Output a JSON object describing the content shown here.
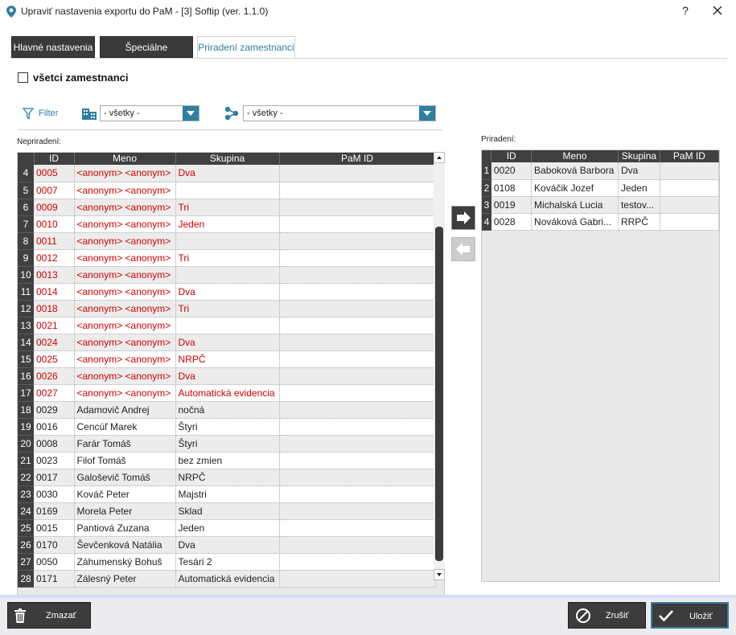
{
  "window": {
    "title": "Upraviť nastavenia exportu do PaM - [3] Softip (ver. 1.1.0)",
    "help_label": "?",
    "icons": {
      "app": "location-pin-icon",
      "close": "close-icon"
    }
  },
  "tabs": [
    {
      "label": "Hlavné nastavenia",
      "active": false
    },
    {
      "label": "Špeciálne nastavenia",
      "active": false
    },
    {
      "label": "Priradení zamestnanci",
      "active": true
    }
  ],
  "all_employees": {
    "label": "všetci zamestnanci",
    "checked": false
  },
  "filters": {
    "filter_label": "Filter",
    "combo1": {
      "value": "- všetky -",
      "icon": "building-icon"
    },
    "combo2": {
      "value": "- všetky -",
      "icon": "network-icon"
    }
  },
  "unassigned": {
    "label": "Nepriradení:",
    "columns": [
      "ID",
      "Meno",
      "Skupina",
      "PaM ID"
    ],
    "rows": [
      {
        "n": "4",
        "id": "0005",
        "meno": "<anonym> <anonym>",
        "skupina": "Dva",
        "pam": "",
        "red": true
      },
      {
        "n": "5",
        "id": "0007",
        "meno": "<anonym> <anonym>",
        "skupina": "",
        "pam": "",
        "red": true
      },
      {
        "n": "6",
        "id": "0009",
        "meno": "<anonym> <anonym>",
        "skupina": "Tri",
        "pam": "",
        "red": true
      },
      {
        "n": "7",
        "id": "0010",
        "meno": "<anonym> <anonym>",
        "skupina": "Jeden",
        "pam": "",
        "red": true
      },
      {
        "n": "8",
        "id": "0011",
        "meno": "<anonym> <anonym>",
        "skupina": "",
        "pam": "",
        "red": true
      },
      {
        "n": "9",
        "id": "0012",
        "meno": "<anonym> <anonym>",
        "skupina": "Tri",
        "pam": "",
        "red": true
      },
      {
        "n": "10",
        "id": "0013",
        "meno": "<anonym> <anonym>",
        "skupina": "",
        "pam": "",
        "red": true
      },
      {
        "n": "11",
        "id": "0014",
        "meno": "<anonym> <anonym>",
        "skupina": "Dva",
        "pam": "",
        "red": true
      },
      {
        "n": "12",
        "id": "0018",
        "meno": "<anonym> <anonym>",
        "skupina": "Tri",
        "pam": "",
        "red": true
      },
      {
        "n": "13",
        "id": "0021",
        "meno": "<anonym> <anonym>",
        "skupina": "",
        "pam": "",
        "red": true
      },
      {
        "n": "14",
        "id": "0024",
        "meno": "<anonym> <anonym>",
        "skupina": "Dva",
        "pam": "",
        "red": true
      },
      {
        "n": "15",
        "id": "0025",
        "meno": "<anonym> <anonym>",
        "skupina": "NRPČ",
        "pam": "",
        "red": true
      },
      {
        "n": "16",
        "id": "0026",
        "meno": "<anonym> <anonym>",
        "skupina": "Dva",
        "pam": "",
        "red": true
      },
      {
        "n": "17",
        "id": "0027",
        "meno": "<anonym> <anonym>",
        "skupina": "Automatická evidencia",
        "pam": "",
        "red": true
      },
      {
        "n": "18",
        "id": "0029",
        "meno": "Adamovič Andrej",
        "skupina": "nočná",
        "pam": "",
        "red": false
      },
      {
        "n": "19",
        "id": "0016",
        "meno": "Cencúľ Marek",
        "skupina": "Štyri",
        "pam": "",
        "red": false
      },
      {
        "n": "20",
        "id": "0008",
        "meno": "Farár Tomáš",
        "skupina": "Štyri",
        "pam": "",
        "red": false
      },
      {
        "n": "21",
        "id": "0023",
        "meno": "Filof Tomáš",
        "skupina": "bez zmien",
        "pam": "",
        "red": false
      },
      {
        "n": "22",
        "id": "0017",
        "meno": "Galoševič Tomáš",
        "skupina": "NRPČ",
        "pam": "",
        "red": false
      },
      {
        "n": "23",
        "id": "0030",
        "meno": "Kováč Peter",
        "skupina": "Majstri",
        "pam": "",
        "red": false
      },
      {
        "n": "24",
        "id": "0169",
        "meno": "Morela Peter",
        "skupina": "Sklad",
        "pam": "",
        "red": false
      },
      {
        "n": "25",
        "id": "0015",
        "meno": "Pantiová Zuzana",
        "skupina": "Jeden",
        "pam": "",
        "red": false
      },
      {
        "n": "26",
        "id": "0170",
        "meno": "Ševčenková Natália",
        "skupina": "Dva",
        "pam": "",
        "red": false
      },
      {
        "n": "27",
        "id": "0050",
        "meno": "Záhumenský Bohuš",
        "skupina": "Tesári 2",
        "pam": "",
        "red": false
      },
      {
        "n": "28",
        "id": "0171",
        "meno": "Zálesný Peter",
        "skupina": "Automatická evidencia",
        "pam": "",
        "red": false
      }
    ]
  },
  "assigned": {
    "label": "Priradení:",
    "columns": [
      "ID",
      "Meno",
      "Skupina",
      "PaM ID"
    ],
    "rows": [
      {
        "n": "1",
        "id": "0020",
        "meno": "Baboková Barbora",
        "skupina": "Dva",
        "pam": ""
      },
      {
        "n": "2",
        "id": "0108",
        "meno": "Kováčik Jozef",
        "skupina": "Jeden",
        "pam": ""
      },
      {
        "n": "3",
        "id": "0019",
        "meno": "Michalská Lucia",
        "skupina": "testov...",
        "pam": ""
      },
      {
        "n": "4",
        "id": "0028",
        "meno": "Nováková Gabri...",
        "skupina": "RRPČ",
        "pam": ""
      }
    ]
  },
  "move_buttons": {
    "right_icon": "arrow-right-icon",
    "left_icon": "arrow-left-icon"
  },
  "footer": {
    "delete_label": "Zmazať",
    "cancel_label": "Zrušiť",
    "save_label": "Uložiť"
  },
  "colors": {
    "accent": "#2f7fa0",
    "dark": "#3c3c3c",
    "error_red": "#d00000"
  }
}
